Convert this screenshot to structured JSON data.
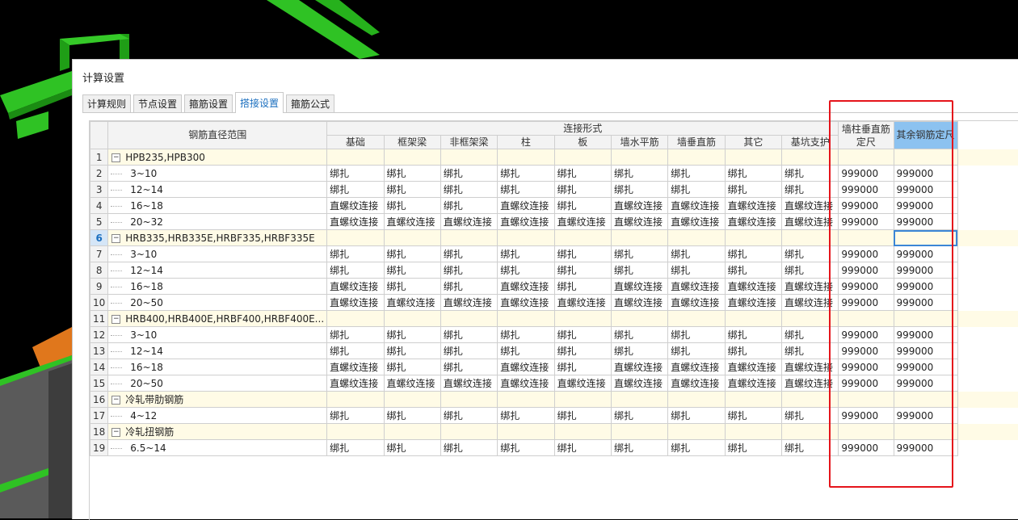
{
  "window": {
    "title": "计算设置"
  },
  "tabs": [
    {
      "label": "计算规则"
    },
    {
      "label": "节点设置"
    },
    {
      "label": "箍筋设置"
    },
    {
      "label": "搭接设置",
      "active": true
    },
    {
      "label": "箍筋公式"
    }
  ],
  "grid": {
    "header": {
      "diameter_range": "钢筋直径范围",
      "connection_form": "连接形式",
      "columns": [
        "基础",
        "框架梁",
        "非框架梁",
        "柱",
        "板",
        "墙水平筋",
        "墙垂直筋",
        "其它",
        "基坑支护"
      ],
      "wall_column_length": "墙柱垂直筋定尺",
      "other_length": "其余钢筋定尺"
    },
    "rows": [
      {
        "num": "1",
        "type": "group",
        "label": "HPB235,HPB300"
      },
      {
        "num": "2",
        "type": "item",
        "label": "3~10",
        "cells": [
          "绑扎",
          "绑扎",
          "绑扎",
          "绑扎",
          "绑扎",
          "绑扎",
          "绑扎",
          "绑扎",
          "绑扎"
        ],
        "len1": "999000",
        "len2": "999000"
      },
      {
        "num": "3",
        "type": "item",
        "label": "12~14",
        "cells": [
          "绑扎",
          "绑扎",
          "绑扎",
          "绑扎",
          "绑扎",
          "绑扎",
          "绑扎",
          "绑扎",
          "绑扎"
        ],
        "len1": "999000",
        "len2": "999000"
      },
      {
        "num": "4",
        "type": "item",
        "label": "16~18",
        "cells": [
          "直螺纹连接",
          "绑扎",
          "绑扎",
          "直螺纹连接",
          "绑扎",
          "直螺纹连接",
          "直螺纹连接",
          "直螺纹连接",
          "直螺纹连接"
        ],
        "len1": "999000",
        "len2": "999000"
      },
      {
        "num": "5",
        "type": "item",
        "label": "20~32",
        "cells": [
          "直螺纹连接",
          "直螺纹连接",
          "直螺纹连接",
          "直螺纹连接",
          "直螺纹连接",
          "直螺纹连接",
          "直螺纹连接",
          "直螺纹连接",
          "直螺纹连接"
        ],
        "len1": "999000",
        "len2": "999000"
      },
      {
        "num": "6",
        "type": "group",
        "label": "HRB335,HRB335E,HRBF335,HRBF335E",
        "selected": true
      },
      {
        "num": "7",
        "type": "item",
        "label": "3~10",
        "cells": [
          "绑扎",
          "绑扎",
          "绑扎",
          "绑扎",
          "绑扎",
          "绑扎",
          "绑扎",
          "绑扎",
          "绑扎"
        ],
        "len1": "999000",
        "len2": "999000"
      },
      {
        "num": "8",
        "type": "item",
        "label": "12~14",
        "cells": [
          "绑扎",
          "绑扎",
          "绑扎",
          "绑扎",
          "绑扎",
          "绑扎",
          "绑扎",
          "绑扎",
          "绑扎"
        ],
        "len1": "999000",
        "len2": "999000"
      },
      {
        "num": "9",
        "type": "item",
        "label": "16~18",
        "cells": [
          "直螺纹连接",
          "绑扎",
          "绑扎",
          "直螺纹连接",
          "绑扎",
          "直螺纹连接",
          "直螺纹连接",
          "直螺纹连接",
          "直螺纹连接"
        ],
        "len1": "999000",
        "len2": "999000"
      },
      {
        "num": "10",
        "type": "item",
        "label": "20~50",
        "cells": [
          "直螺纹连接",
          "直螺纹连接",
          "直螺纹连接",
          "直螺纹连接",
          "直螺纹连接",
          "直螺纹连接",
          "直螺纹连接",
          "直螺纹连接",
          "直螺纹连接"
        ],
        "len1": "999000",
        "len2": "999000"
      },
      {
        "num": "11",
        "type": "group",
        "label": "HRB400,HRB400E,HRBF400,HRBF400E..."
      },
      {
        "num": "12",
        "type": "item",
        "label": "3~10",
        "cells": [
          "绑扎",
          "绑扎",
          "绑扎",
          "绑扎",
          "绑扎",
          "绑扎",
          "绑扎",
          "绑扎",
          "绑扎"
        ],
        "len1": "999000",
        "len2": "999000"
      },
      {
        "num": "13",
        "type": "item",
        "label": "12~14",
        "cells": [
          "绑扎",
          "绑扎",
          "绑扎",
          "绑扎",
          "绑扎",
          "绑扎",
          "绑扎",
          "绑扎",
          "绑扎"
        ],
        "len1": "999000",
        "len2": "999000"
      },
      {
        "num": "14",
        "type": "item",
        "label": "16~18",
        "cells": [
          "直螺纹连接",
          "绑扎",
          "绑扎",
          "直螺纹连接",
          "绑扎",
          "直螺纹连接",
          "直螺纹连接",
          "直螺纹连接",
          "直螺纹连接"
        ],
        "len1": "999000",
        "len2": "999000"
      },
      {
        "num": "15",
        "type": "item",
        "label": "20~50",
        "cells": [
          "直螺纹连接",
          "直螺纹连接",
          "直螺纹连接",
          "直螺纹连接",
          "直螺纹连接",
          "直螺纹连接",
          "直螺纹连接",
          "直螺纹连接",
          "直螺纹连接"
        ],
        "len1": "999000",
        "len2": "999000"
      },
      {
        "num": "16",
        "type": "group",
        "label": "冷轧带肋钢筋"
      },
      {
        "num": "17",
        "type": "item",
        "label": "4~12",
        "cells": [
          "绑扎",
          "绑扎",
          "绑扎",
          "绑扎",
          "绑扎",
          "绑扎",
          "绑扎",
          "绑扎",
          "绑扎"
        ],
        "len1": "999000",
        "len2": "999000"
      },
      {
        "num": "18",
        "type": "group",
        "label": "冷轧扭钢筋"
      },
      {
        "num": "19",
        "type": "item",
        "label": "6.5~14",
        "cells": [
          "绑扎",
          "绑扎",
          "绑扎",
          "绑扎",
          "绑扎",
          "绑扎",
          "绑扎",
          "绑扎",
          "绑扎"
        ],
        "len1": "999000",
        "len2": "999000"
      }
    ],
    "expander_symbol": "−"
  },
  "colors": {
    "highlight_box": "#e5141b",
    "selected_header": "#8cc2f0",
    "group_row": "#fffbe6",
    "model_green": "#22b518",
    "model_orange": "#e0771c"
  }
}
